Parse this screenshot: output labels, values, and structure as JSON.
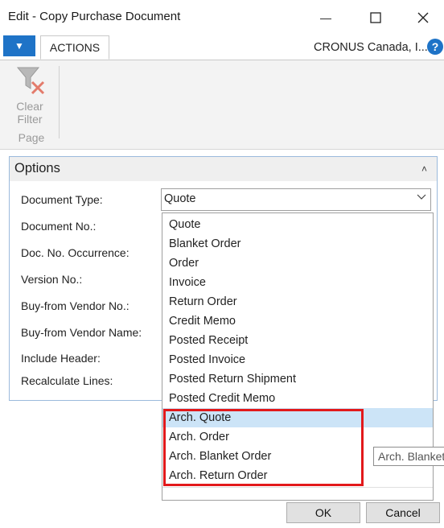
{
  "window": {
    "title": "Edit - Copy Purchase Document",
    "minimize_glyph": "—",
    "maximize_glyph": "☐",
    "close_glyph": "✕"
  },
  "ribbon": {
    "app_menu_glyph": "▼",
    "tab_actions": "ACTIONS",
    "company": "CRONUS Canada, I...",
    "help_glyph": "?",
    "clear_filter_line1": "Clear",
    "clear_filter_line2": "Filter",
    "group_label": "Page",
    "clear_filter_icon": "filter-clear-icon"
  },
  "options": {
    "title": "Options",
    "collapse_glyph": "˄",
    "labels": {
      "document_type": "Document Type:",
      "document_no": "Document No.:",
      "doc_no_occurrence": "Doc. No. Occurrence:",
      "version_no": "Version No.:",
      "buy_from_vendor_no": "Buy-from Vendor No.:",
      "buy_from_vendor_name": "Buy-from Vendor Name:",
      "include_header": "Include Header:",
      "recalculate_lines": "Recalculate Lines:"
    },
    "document_type_value": "Quote",
    "chevron_glyph": "⌄"
  },
  "dropdown": {
    "options": [
      "Quote",
      "Blanket Order",
      "Order",
      "Invoice",
      "Return Order",
      "Credit Memo",
      "Posted Receipt",
      "Posted Invoice",
      "Posted Return Shipment",
      "Posted Credit Memo",
      "Arch. Quote",
      "Arch. Order",
      "Arch. Blanket Order",
      "Arch. Return Order"
    ],
    "selected": "Arch. Quote"
  },
  "tooltip": "Arch. Blanket Order",
  "buttons": {
    "ok": "OK",
    "cancel": "Cancel"
  },
  "colors": {
    "accent": "#1e73c7",
    "highlight_box": "#e2191b",
    "selected_option": "#cce4f7"
  }
}
